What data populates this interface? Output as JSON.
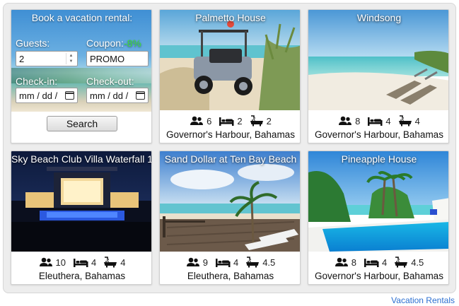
{
  "widget": {
    "title": "Book a vacation rental:",
    "guests_label": "Guests:",
    "guests_value": "2",
    "coupon_label": "Coupon:",
    "coupon_discount": "-8%",
    "coupon_value": "PROMO",
    "checkin_label": "Check-in:",
    "checkout_label": "Check-out:",
    "date_placeholder": "mm / dd / ",
    "search_label": "Search"
  },
  "properties": [
    {
      "name": "Palmetto House",
      "guests": "6",
      "beds": "2",
      "baths": "2",
      "location": "Governor's Harbour, Bahamas"
    },
    {
      "name": "Windsong",
      "guests": "8",
      "beds": "4",
      "baths": "4",
      "location": "Governor's Harbour, Bahamas"
    },
    {
      "name": "Sky Beach Club Villa Waterfall 1",
      "guests": "10",
      "beds": "4",
      "baths": "4",
      "location": "Eleuthera, Bahamas"
    },
    {
      "name": "Sand Dollar at Ten Bay Beach",
      "guests": "9",
      "beds": "4",
      "baths": "4.5",
      "location": "Eleuthera, Bahamas"
    },
    {
      "name": "Pineapple House",
      "guests": "8",
      "beds": "4",
      "baths": "4.5",
      "location": "Governor's Harbour, Bahamas"
    }
  ],
  "footer": {
    "link": "Vacation Rentals"
  },
  "colors": {
    "accent_link": "#2b6fd1",
    "discount": "#3be23b"
  },
  "icons": {
    "guests": "people-icon",
    "beds": "bed-icon",
    "baths": "bathtub-icon",
    "calendar": "calendar-icon"
  }
}
